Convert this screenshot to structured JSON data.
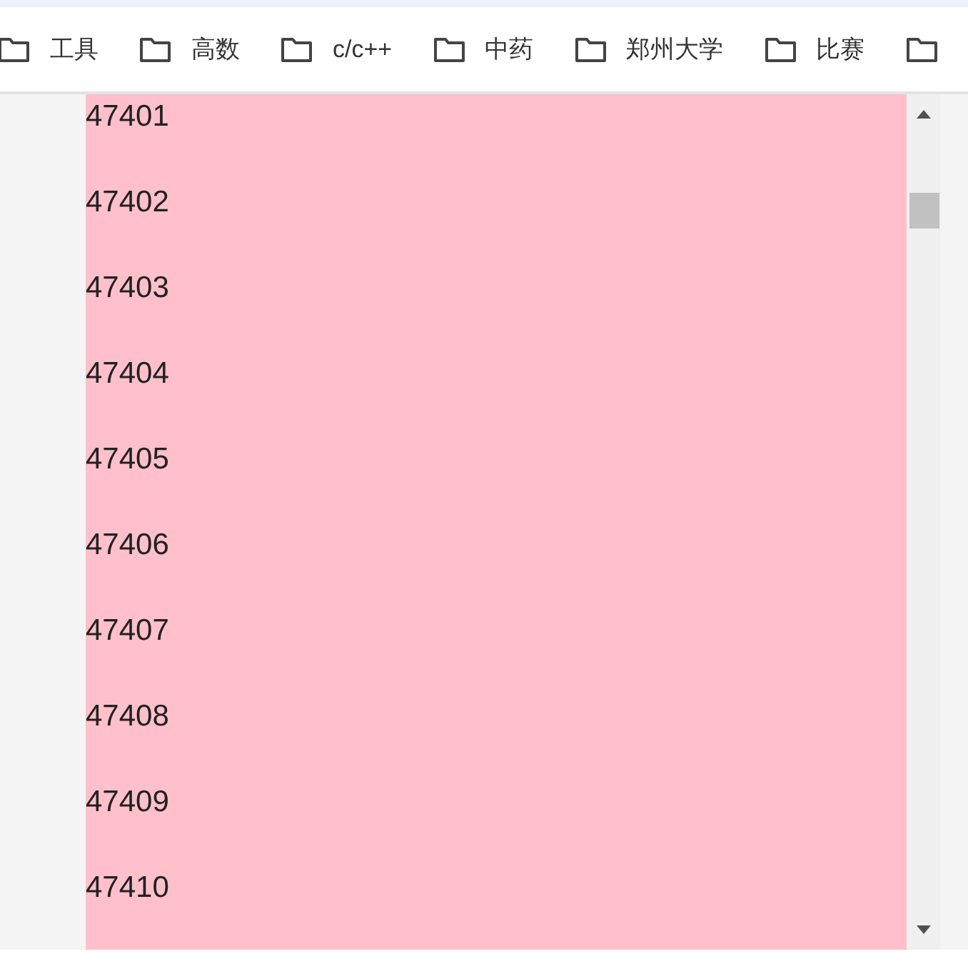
{
  "bookmarks_bar": {
    "items": [
      {
        "label": "工具"
      },
      {
        "label": "高数"
      },
      {
        "label": "c/c++"
      },
      {
        "label": "中药"
      },
      {
        "label": "郑州大学"
      },
      {
        "label": "比赛"
      }
    ]
  },
  "content": {
    "lines": [
      "47401",
      "47402",
      "47403",
      "47404",
      "47405",
      "47406",
      "47407",
      "47408",
      "47409",
      "47410"
    ]
  }
}
